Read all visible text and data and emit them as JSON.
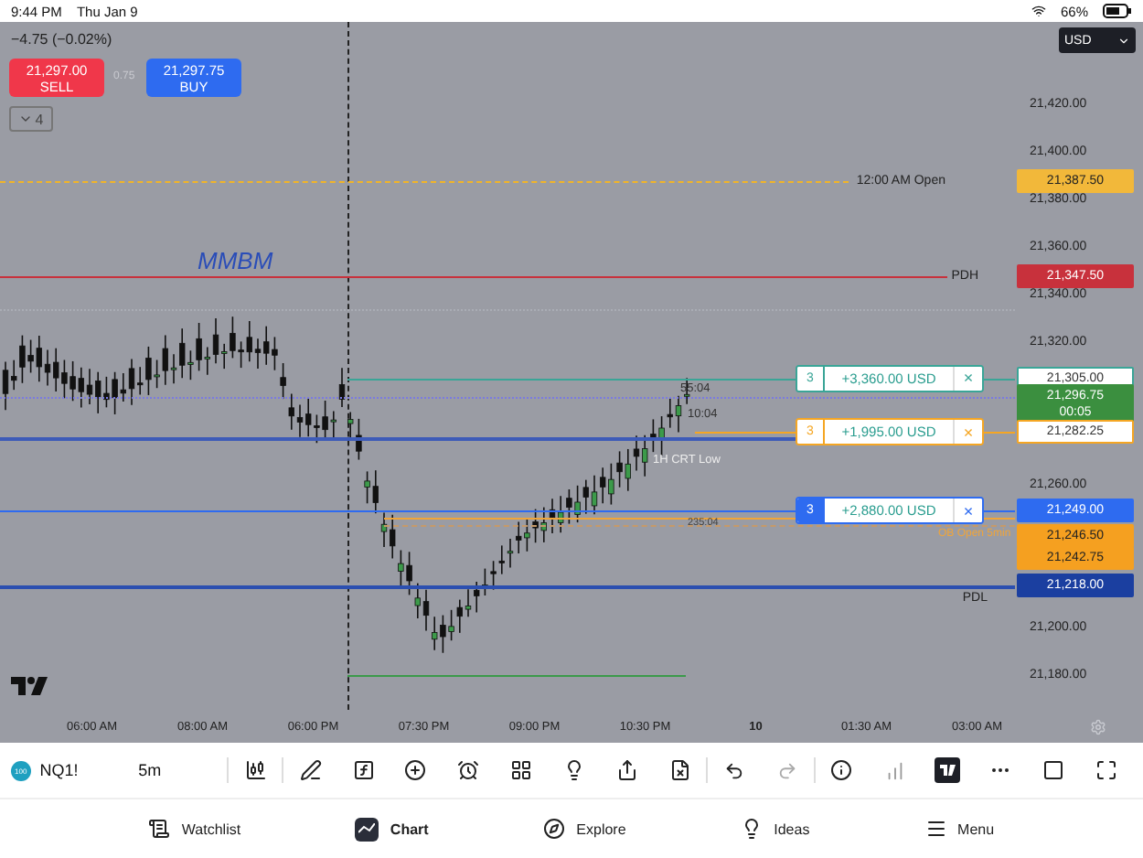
{
  "status_bar": {
    "time": "9:44 PM",
    "date": "Thu Jan 9",
    "battery": "66%"
  },
  "header": {
    "change": "−4.75 (−0.02%)",
    "sell": {
      "price": "21,297.00",
      "label": "SELL"
    },
    "spread": "0.75",
    "buy": {
      "price": "21,297.75",
      "label": "BUY"
    },
    "collapse_count": "4"
  },
  "currency": "USD",
  "price_axis": [
    "21,420.00",
    "21,400.00",
    "21,380.00",
    "21,360.00",
    "21,340.00",
    "21,320.00",
    "21,260.00",
    "21,200.00",
    "21,180.00"
  ],
  "levels": [
    {
      "label": "12:00 AM Open",
      "color": "#f0b429",
      "kind": "dashed"
    },
    {
      "label": "PDH",
      "color": "#c8313c",
      "kind": "solid"
    },
    {
      "label": "PDL",
      "color": "#2c4fb0",
      "kind": "solid"
    }
  ],
  "price_tags": [
    {
      "text": "21,387.50",
      "color": "#f2b83a",
      "kind": "filled"
    },
    {
      "text": "21,347.50",
      "color": "#c8313c",
      "kind": "filled"
    },
    {
      "text": "21,305.00",
      "color": "#3aa597",
      "kind": "outlined"
    },
    {
      "text": "21,296.75",
      "sub": "00:05",
      "color": "#3b8f3f",
      "kind": "filled"
    },
    {
      "text": "21,282.25",
      "color": "#f5a623",
      "kind": "outlined"
    },
    {
      "text": "21,249.00",
      "color": "#2e6bf0",
      "kind": "filled"
    },
    {
      "text": "21,246.50",
      "color": "#f5a020",
      "kind": "filled"
    },
    {
      "text": "21,242.75",
      "color": "#f5a020",
      "kind": "filled"
    },
    {
      "text": "21,218.00",
      "color": "#1b3fa0",
      "kind": "filled"
    }
  ],
  "positions": [
    {
      "qty": "3",
      "pnl": "+3,360.00 USD",
      "close": "×",
      "color": "#3aa597",
      "kind": "outlined"
    },
    {
      "qty": "3",
      "pnl": "+1,995.00 USD",
      "close": "×",
      "color": "#f5a623",
      "kind": "outlined"
    },
    {
      "qty": "3",
      "pnl": "+2,880.00 USD",
      "close": "×",
      "color": "#2e6bf0",
      "kind": "filled"
    }
  ],
  "annotations": [
    "MMBM",
    "55:04",
    "10:04",
    "1H CRT Low",
    "235:04",
    "OB Open 5min"
  ],
  "time_axis": [
    {
      "label": "06:00 AM",
      "kind": "time"
    },
    {
      "label": "08:00 AM",
      "kind": "time"
    },
    {
      "label": "06:00 PM",
      "kind": "time"
    },
    {
      "label": "07:30 PM",
      "kind": "time"
    },
    {
      "label": "09:00 PM",
      "kind": "time"
    },
    {
      "label": "10:30 PM",
      "kind": "time"
    },
    {
      "label": "10",
      "kind": "day"
    },
    {
      "label": "01:30 AM",
      "kind": "time"
    },
    {
      "label": "03:00 AM",
      "kind": "time"
    }
  ],
  "toolbar": {
    "symbol_badge": "100",
    "symbol": "NQ1!",
    "interval": "5m"
  },
  "nav": [
    {
      "label": "Watchlist",
      "selected": false
    },
    {
      "label": "Chart",
      "selected": true
    },
    {
      "label": "Explore",
      "selected": false
    },
    {
      "label": "Ideas",
      "selected": false
    },
    {
      "label": "Menu",
      "selected": false
    }
  ]
}
